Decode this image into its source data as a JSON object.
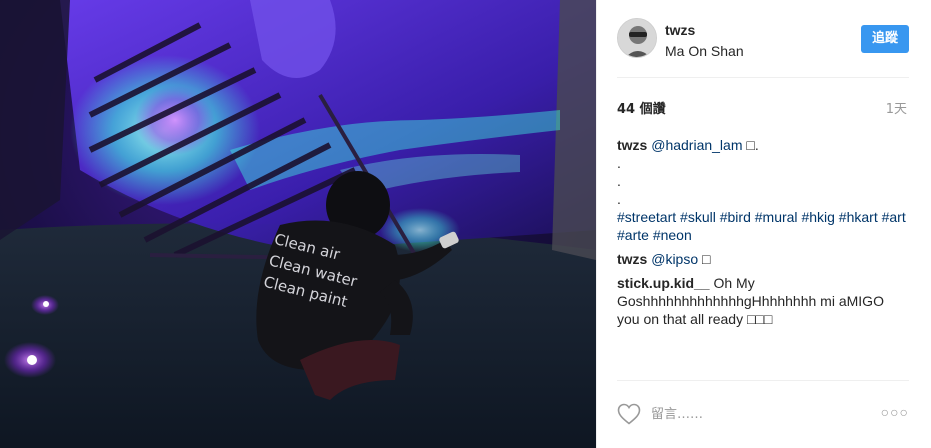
{
  "post": {
    "username": "twzs",
    "location": "Ma On Shan",
    "follow_label": "追蹤",
    "likes": "44 個讚",
    "time_ago": "1天"
  },
  "photo": {
    "shirt_lines": [
      "Clean air",
      "Clean water",
      "Clean paint"
    ]
  },
  "comments": [
    {
      "user": "twzs",
      "mention": "@hadrian_lam",
      "tail": " □.",
      "dots": [
        ".",
        ".",
        "."
      ],
      "hashtags": [
        "#streetart",
        "#skull",
        "#bird",
        "#mural",
        "#hkig",
        "#hkart",
        "#art",
        "#arte",
        "#neon"
      ]
    },
    {
      "user": "twzs",
      "mention": "@kipso",
      "tail": " □"
    },
    {
      "user": "stick.up.kid__",
      "text": "Oh My GoshhhhhhhhhhhhhgHhhhhhhh mi aMIGO you on that all ready □□□"
    }
  ],
  "actions": {
    "comment_placeholder": "留言……",
    "more_label": "○○○"
  },
  "colors": {
    "accent": "#3897f0",
    "link": "#003569",
    "muted": "#999999",
    "neon_purple": "#5a2bd6",
    "neon_cyan": "#3ef0e0"
  },
  "icons": {
    "like": "heart-icon",
    "more": "more-options-icon"
  }
}
